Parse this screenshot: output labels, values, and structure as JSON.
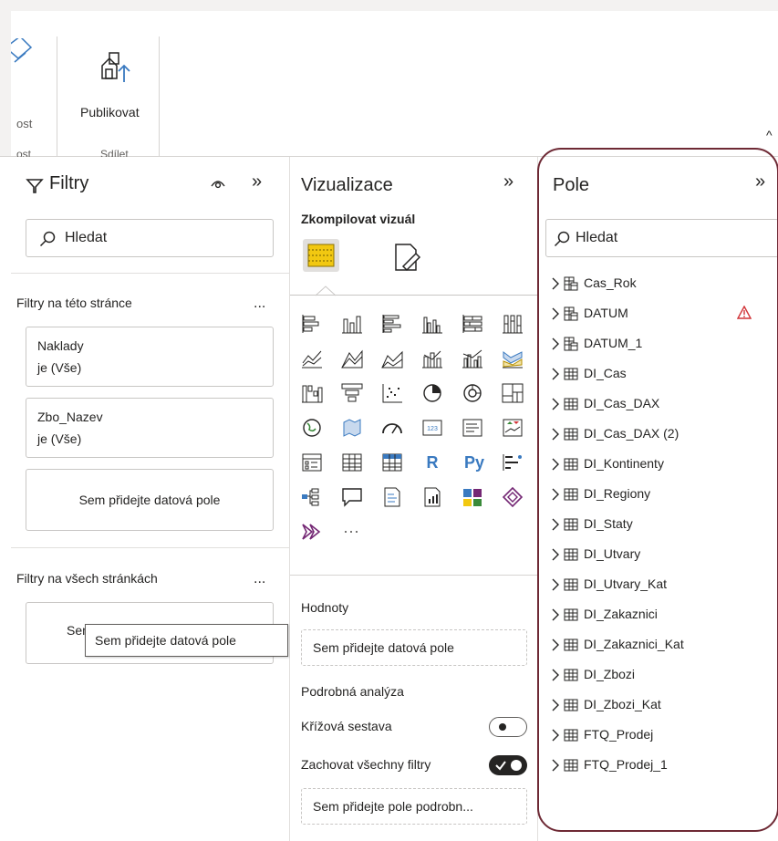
{
  "ribbon": {
    "prev_label": "ost",
    "prev_group": "ost",
    "publish_label": "Publikovat",
    "share_group": "Sdílet",
    "collapse_glyph": "^"
  },
  "filters": {
    "title": "Filtry",
    "expand_glyph": "»",
    "search_text": "Hledat",
    "section_page": "Filtry na této stránce",
    "section_all": "Filtry na všech stránkách",
    "more_glyph": "...",
    "cards": [
      {
        "line1": "Naklady",
        "line2": "je (Vše)"
      },
      {
        "line1": "Zbo_Nazev",
        "line2": "je (Vše)"
      }
    ],
    "add_field_page": "Sem přidejte datová pole",
    "add_field_all_partial": "Sem",
    "tooltip": "Sem přidejte datová pole"
  },
  "visualizations": {
    "title": "Vizualizace",
    "expand_glyph": "»",
    "build_label": "Zkompilovat vizuál",
    "more_glyph": "···",
    "r_label": "R",
    "py_label": "Py",
    "values_label": "Hodnoty",
    "values_drop": "Sem přidejte datová pole",
    "drill_label": "Podrobná analýza",
    "cross_report_label": "Křížová sestava",
    "keep_filters_label": "Zachovat všechny filtry",
    "drill_drop": "Sem přidejte pole podrobn..."
  },
  "fields": {
    "title": "Pole",
    "expand_glyph": "»",
    "search_text": "Hledat",
    "tables": [
      {
        "name": "Cas_Rok",
        "icon": "calendar-table-icon",
        "warning": false
      },
      {
        "name": "DATUM",
        "icon": "calendar-table-icon",
        "warning": true
      },
      {
        "name": "DATUM_1",
        "icon": "calendar-table-icon",
        "warning": false
      },
      {
        "name": "DI_Cas",
        "icon": "table-icon",
        "warning": false
      },
      {
        "name": "DI_Cas_DAX",
        "icon": "table-icon",
        "warning": false
      },
      {
        "name": "DI_Cas_DAX (2)",
        "icon": "table-icon",
        "warning": false
      },
      {
        "name": "DI_Kontinenty",
        "icon": "table-icon",
        "warning": false
      },
      {
        "name": "DI_Regiony",
        "icon": "table-icon",
        "warning": false
      },
      {
        "name": "DI_Staty",
        "icon": "table-icon",
        "warning": false
      },
      {
        "name": "DI_Utvary",
        "icon": "table-icon",
        "warning": false
      },
      {
        "name": "DI_Utvary_Kat",
        "icon": "table-icon",
        "warning": false
      },
      {
        "name": "DI_Zakaznici",
        "icon": "table-icon",
        "warning": false
      },
      {
        "name": "DI_Zakaznici_Kat",
        "icon": "table-icon",
        "warning": false
      },
      {
        "name": "DI_Zbozi",
        "icon": "table-icon",
        "warning": false
      },
      {
        "name": "DI_Zbozi_Kat",
        "icon": "table-icon",
        "warning": false
      },
      {
        "name": "FTQ_Prodej",
        "icon": "table-icon",
        "warning": false
      },
      {
        "name": "FTQ_Prodej_1",
        "icon": "table-icon",
        "warning": false
      }
    ]
  },
  "colors": {
    "highlight_border": "#6e2a35",
    "warning": "#d13438",
    "accent_yellow": "#f2c811"
  }
}
